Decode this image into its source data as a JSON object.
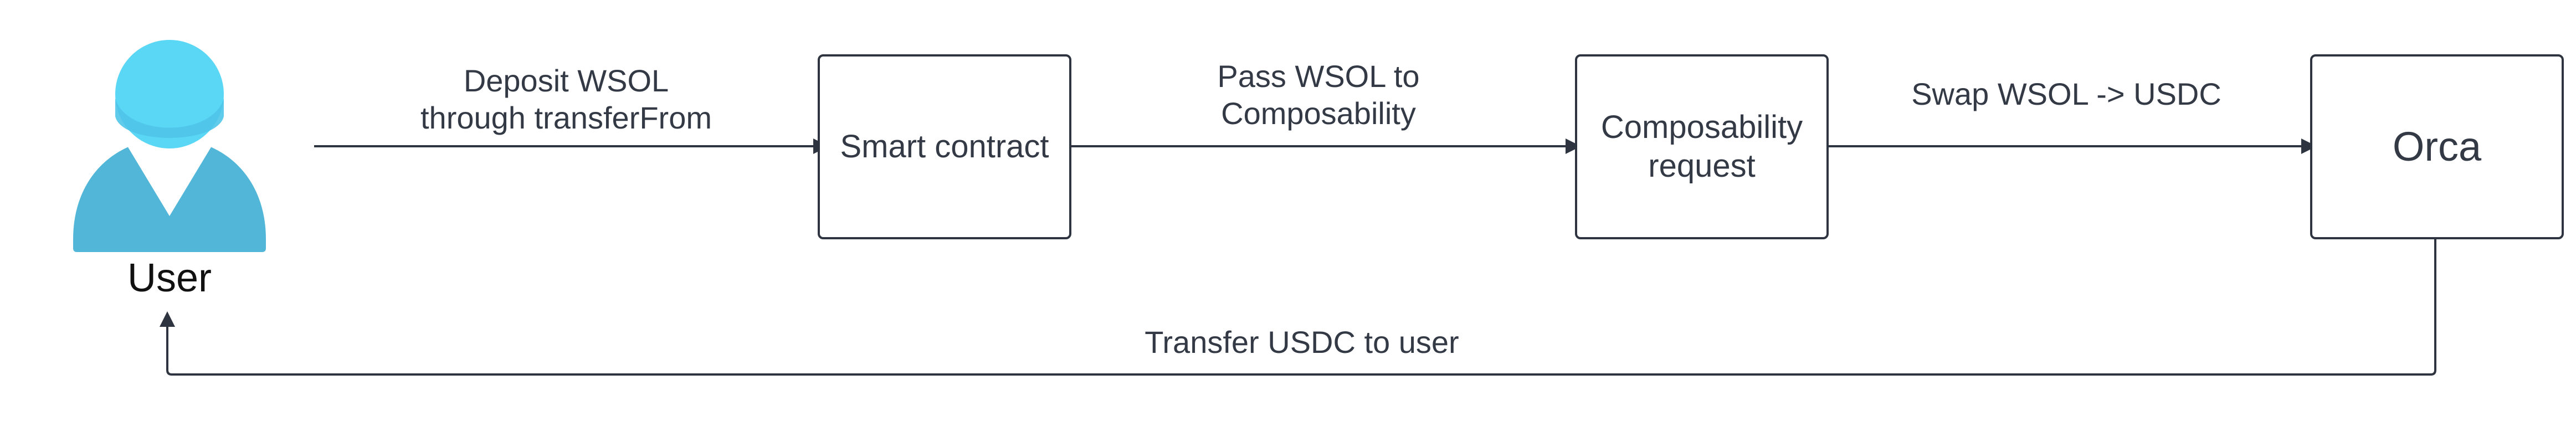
{
  "diagram": {
    "actor": {
      "label": "User",
      "icon": "user-icon",
      "colors": {
        "head": "#5bd7f6",
        "body": "#52b6d8"
      }
    },
    "nodes": [
      {
        "id": "smart-contract",
        "label": "Smart contract"
      },
      {
        "id": "composability-request",
        "label_lines": [
          "Composability",
          "request"
        ]
      },
      {
        "id": "orca",
        "label": "Orca"
      }
    ],
    "edges": [
      {
        "from": "User",
        "to": "Smart contract",
        "label_lines": [
          "Deposit WSOL",
          "through transferFrom"
        ]
      },
      {
        "from": "Smart contract",
        "to": "Composability request",
        "label_lines": [
          "Pass WSOL to",
          "Composability"
        ]
      },
      {
        "from": "Composability request",
        "to": "Orca",
        "label": "Swap  WSOL -> USDC"
      },
      {
        "from": "Orca",
        "to": "User",
        "label": "Transfer USDC to user"
      }
    ],
    "colors": {
      "line": "#2f3540",
      "text": "#333a45",
      "actor_text": "#111111"
    }
  }
}
